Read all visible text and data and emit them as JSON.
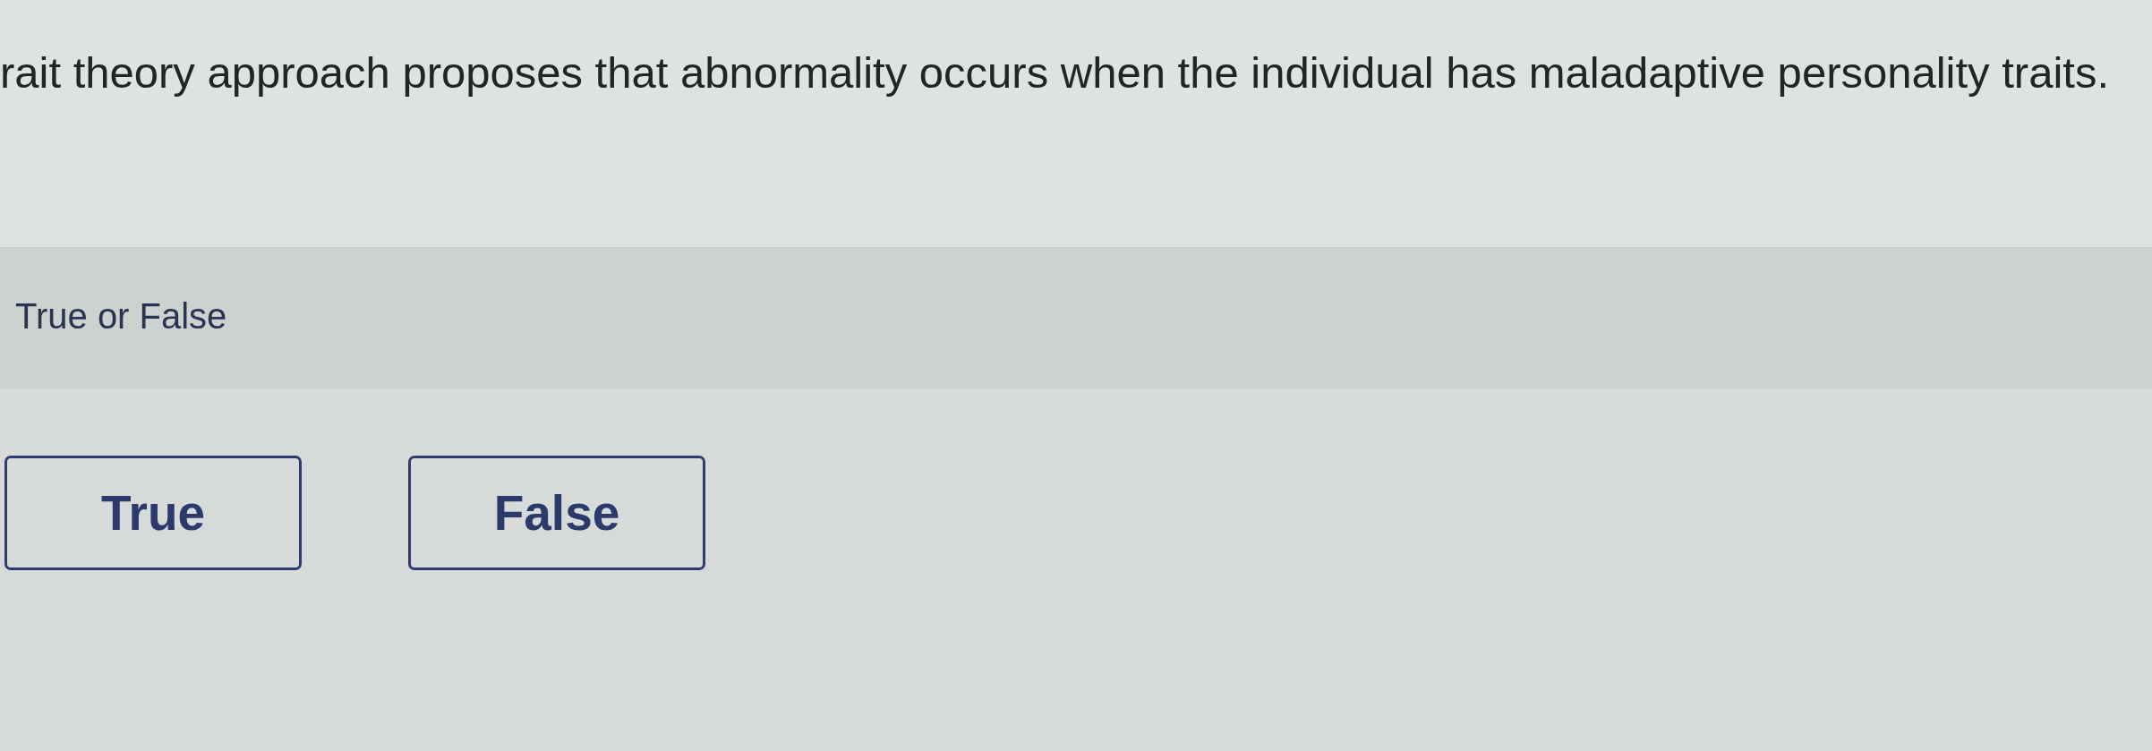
{
  "question": {
    "text": "rait theory approach proposes that abnormality occurs when the individual has maladaptive personality traits."
  },
  "prompt": {
    "text": "True or False"
  },
  "options": [
    {
      "label": "True",
      "selected": false
    },
    {
      "label": "False",
      "selected": false
    }
  ]
}
